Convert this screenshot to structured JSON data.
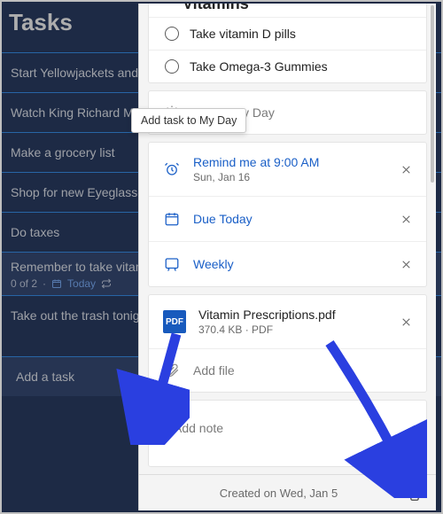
{
  "header": {
    "title": "Tasks"
  },
  "bg_tasks": [
    {
      "label": "Start Yellowjackets and Dopesick"
    },
    {
      "label": "Watch King Richard Movie"
    },
    {
      "label": "Make a grocery list"
    },
    {
      "label": "Shop for new Eyeglasses"
    },
    {
      "label": "Do taxes"
    },
    {
      "label": "Remember to take vitamins",
      "sub_count": "0 of 2",
      "sub_due": "Today"
    },
    {
      "label": "Take out the trash tonight"
    }
  ],
  "bg_add": {
    "label": "Add a task"
  },
  "detail": {
    "title": "Vitamins",
    "steps": [
      {
        "label": "Take vitamin D pills"
      },
      {
        "label": "Take Omega-3 Gummies"
      }
    ],
    "tooltip": "Add task to My Day",
    "my_day": {
      "label": "Add to My Day"
    },
    "reminder": {
      "label": "Remind me at 9:00 AM",
      "sub": "Sun, Jan 16"
    },
    "due": {
      "label": "Due Today"
    },
    "repeat": {
      "label": "Weekly"
    },
    "attachment": {
      "name": "Vitamin Prescriptions.pdf",
      "meta": "370.4 KB · PDF",
      "badge": "PDF"
    },
    "add_file": {
      "label": "Add file"
    },
    "note": {
      "placeholder": "Add note"
    },
    "footer": {
      "created": "Created on Wed, Jan 5"
    }
  }
}
